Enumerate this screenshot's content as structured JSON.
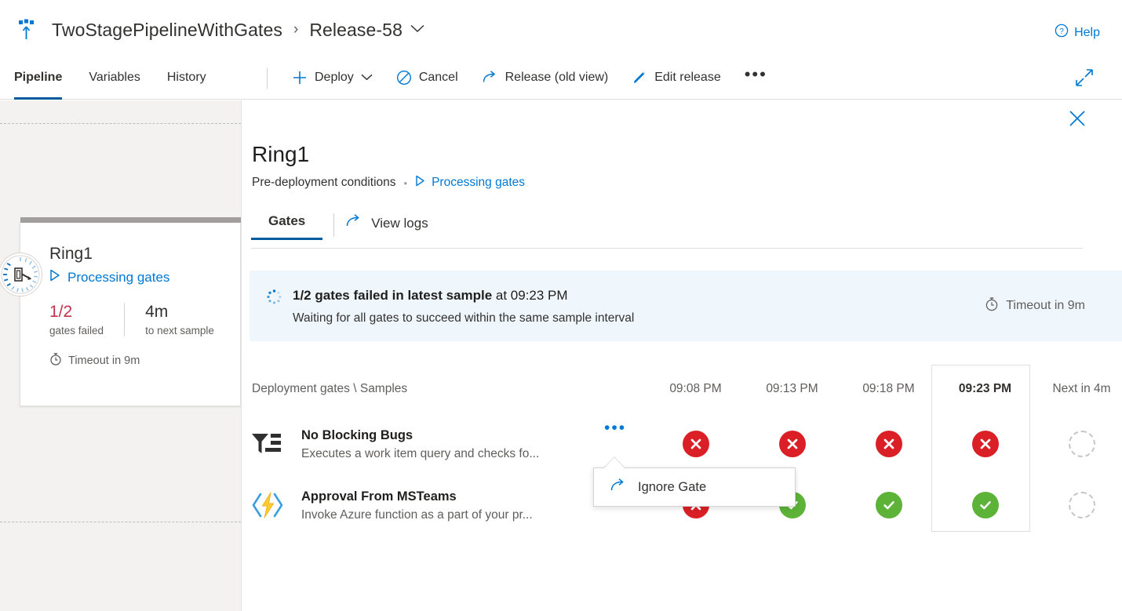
{
  "header": {
    "pipeline_name": "TwoStagePipelineWithGates",
    "separator": "›",
    "release_name": "Release-58",
    "help_label": "Help",
    "logo_icon": "pipeline-release-icon",
    "release_caret_icon": "chevron-down-icon",
    "help_icon": "help-circle-icon"
  },
  "commandbar": {
    "tabs": [
      {
        "label": "Pipeline",
        "active": true
      },
      {
        "label": "Variables",
        "active": false
      },
      {
        "label": "History",
        "active": false
      }
    ],
    "actions": [
      {
        "label": "Deploy",
        "icon": "plus-icon",
        "caret": true
      },
      {
        "label": "Cancel",
        "icon": "cancel-circle-icon",
        "caret": false
      },
      {
        "label": "Release (old view)",
        "icon": "open-external-icon",
        "caret": false
      },
      {
        "label": "Edit release",
        "icon": "pencil-icon",
        "caret": false
      }
    ],
    "overflow_label": "•••",
    "expand_icon": "expand-diagonal-icon"
  },
  "canvas": {
    "card": {
      "title": "Ring1",
      "status_label": "Processing gates",
      "status_icon": "play-triangle-icon",
      "gate_icon": "gate-spinner-icon",
      "stats": [
        {
          "value": "1/2",
          "label": "gates failed",
          "emphasis": "red"
        },
        {
          "value": "4m",
          "label": "to next sample",
          "emphasis": "normal"
        }
      ],
      "timeout_label": "Timeout in 9m",
      "timeout_icon": "stopwatch-icon"
    }
  },
  "panel": {
    "close_icon": "close-icon",
    "title": "Ring1",
    "subtitle": "Pre-deployment conditions",
    "subtitle_dot": "•",
    "subtitle_status": "Processing gates",
    "subtitle_status_icon": "play-triangle-icon",
    "tabs": {
      "gates_label": "Gates",
      "view_logs_label": "View logs",
      "view_logs_icon": "open-external-icon"
    },
    "banner": {
      "spinner_icon": "loading-spinner-icon",
      "headline_bold": "1/2 gates failed in latest sample",
      "headline_rest": " at 09:23 PM",
      "subline": "Waiting for all gates to succeed within the same sample interval",
      "timeout_label": "Timeout in 9m",
      "timeout_icon": "stopwatch-icon"
    },
    "table": {
      "row_header_label": "Deployment gates \\ Samples",
      "columns": [
        {
          "label": "09:08 PM",
          "current": false
        },
        {
          "label": "09:13 PM",
          "current": false
        },
        {
          "label": "09:18 PM",
          "current": false
        },
        {
          "label": "09:23 PM",
          "current": true
        },
        {
          "label": "Next in 4m",
          "current": false
        }
      ],
      "rows": [
        {
          "name": "No Blocking Bugs",
          "description": "Executes a work item query and checks fo...",
          "icon": "work-item-query-filter-icon",
          "more_label": "•••",
          "statuses": [
            "fail",
            "fail",
            "fail",
            "fail",
            "pending"
          ]
        },
        {
          "name": "Approval From MSTeams",
          "description": "Invoke Azure function as a part of your pr...",
          "icon": "azure-function-icon",
          "more_label": "•••",
          "statuses": [
            "fail",
            "pass",
            "pass",
            "pass",
            "pending"
          ]
        }
      ]
    },
    "callout": {
      "item_label": "Ignore Gate",
      "item_icon": "ignore-gate-arrow-icon"
    }
  },
  "colors": {
    "accent": "#0078d4",
    "accent_dark": "#005a9e",
    "fail": "#da1f26",
    "pass": "#5cb338",
    "red_text": "#c4314b",
    "banner_bg": "#eff6fc",
    "canvas_bg": "#f3f2f1"
  }
}
